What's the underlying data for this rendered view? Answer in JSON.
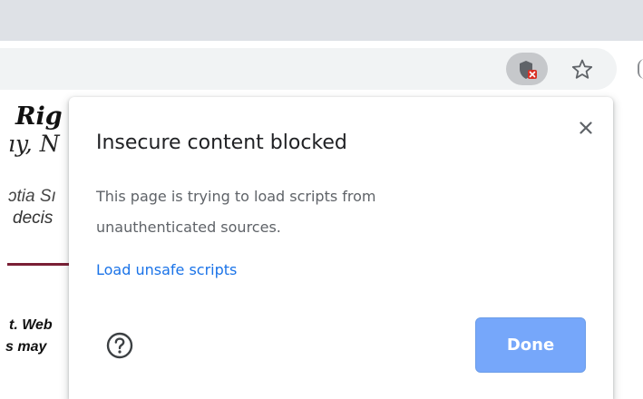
{
  "colors": {
    "tabstrip_bg": "#dee1e6",
    "omnibox_bg": "#f1f3f4",
    "accent_link": "#1a73e8",
    "done_button_bg": "#76a7fa",
    "blocked_badge": "#d93025",
    "divider": "#7a1f35"
  },
  "toolbar": {
    "icons": [
      "insecure-content-blocked-icon",
      "bookmark-star-icon"
    ]
  },
  "background_page": {
    "title_fragment": "Rig",
    "subtitle_fragment": "ıy, N",
    "line1_fragment": "ɔtia Sı",
    "line2_fragment": "decis",
    "line3_fragment": "t. Web",
    "line4_fragment": "s may"
  },
  "popup": {
    "title": "Insecure content blocked",
    "message": "This page is trying to load scripts from unauthenticated sources.",
    "link_label": "Load unsafe scripts",
    "done_label": "Done",
    "help_icon": "help-circle-icon",
    "close_icon": "close-icon"
  }
}
